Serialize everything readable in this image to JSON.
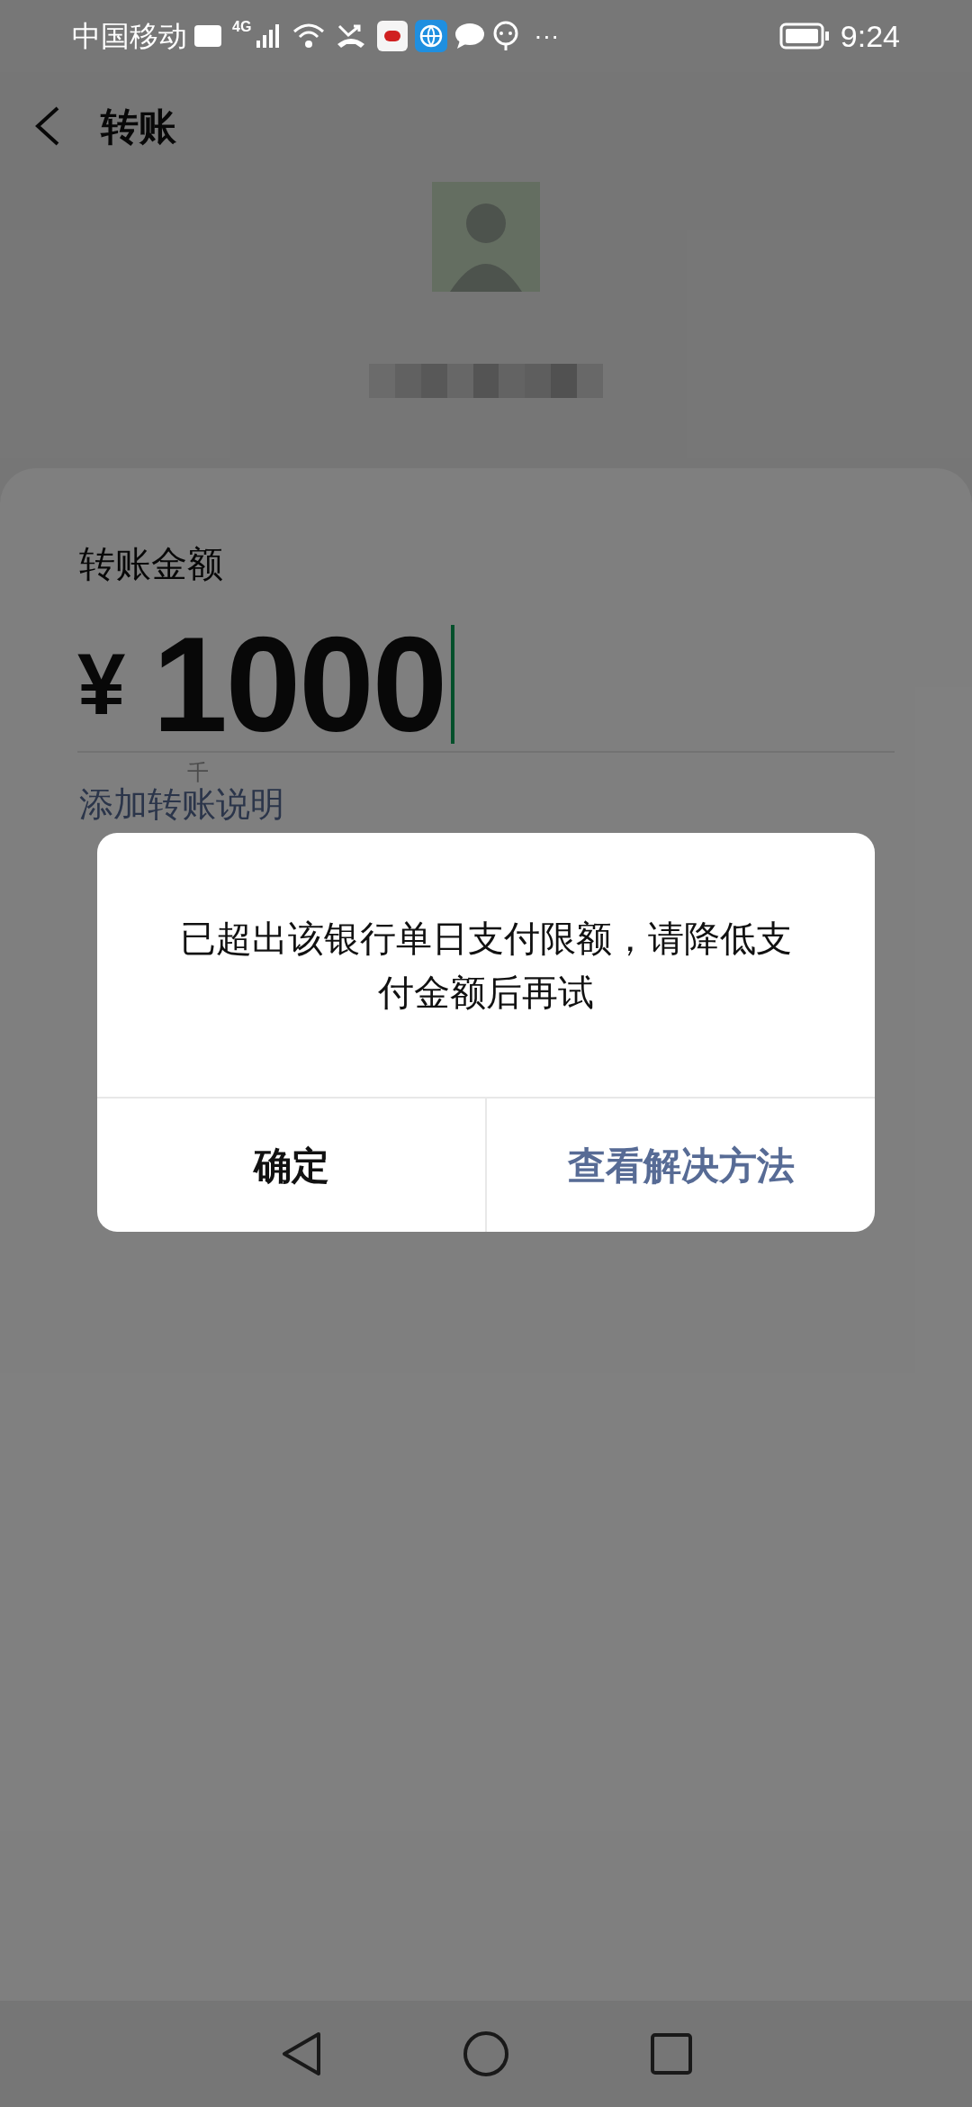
{
  "status_bar": {
    "carrier": "中国移动",
    "network": "4G",
    "more": "···",
    "time": "9:24"
  },
  "header": {
    "title": "转账"
  },
  "amount_label": "转账金额",
  "amount": {
    "currency": "¥",
    "value": "1000",
    "unit_hint": "千"
  },
  "note_link": "添加转账说明",
  "dialog": {
    "message": "已超出该银行单日支付限额，请降低支付金额后再试",
    "buttons": [
      {
        "label": "确定",
        "kind": "confirm"
      },
      {
        "label": "查看解决方法",
        "kind": "link"
      }
    ]
  }
}
